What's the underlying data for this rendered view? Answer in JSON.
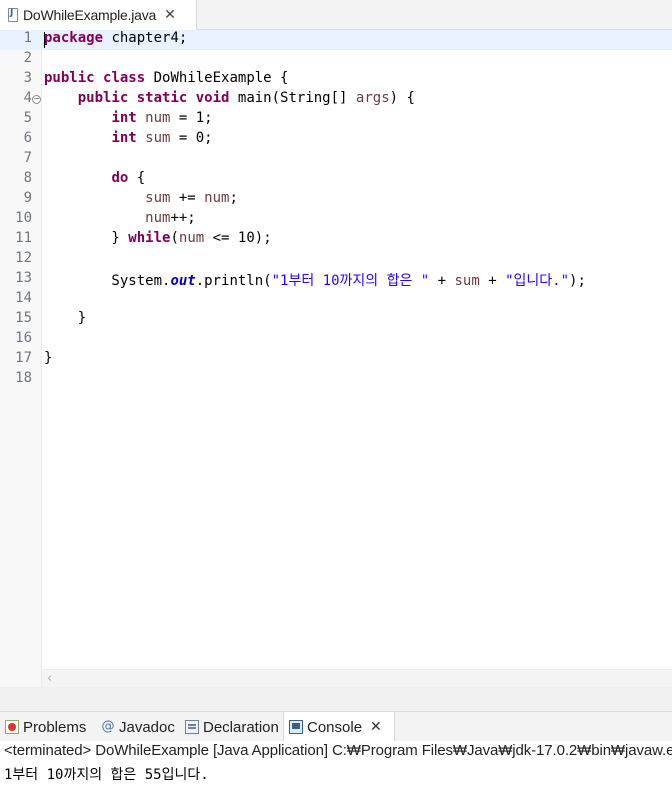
{
  "editor_tab": {
    "title": "DoWhileExample.java",
    "close_glyph": "✕"
  },
  "code_lines": [
    {
      "n": "1",
      "tokens": [
        {
          "t": "package",
          "c": "kw"
        },
        {
          "t": " chapter4;",
          "c": ""
        }
      ]
    },
    {
      "n": "2",
      "tokens": []
    },
    {
      "n": "3",
      "tokens": [
        {
          "t": "public",
          "c": "kw"
        },
        {
          "t": " ",
          "c": ""
        },
        {
          "t": "class",
          "c": "kw"
        },
        {
          "t": " DoWhileExample {",
          "c": ""
        }
      ]
    },
    {
      "n": "4",
      "fold": true,
      "tokens": [
        {
          "t": "    ",
          "c": ""
        },
        {
          "t": "public",
          "c": "kw"
        },
        {
          "t": " ",
          "c": ""
        },
        {
          "t": "static",
          "c": "kw"
        },
        {
          "t": " ",
          "c": ""
        },
        {
          "t": "void",
          "c": "kw"
        },
        {
          "t": " main(String[] ",
          "c": ""
        },
        {
          "t": "args",
          "c": "param"
        },
        {
          "t": ") {",
          "c": ""
        }
      ]
    },
    {
      "n": "5",
      "tokens": [
        {
          "t": "        ",
          "c": ""
        },
        {
          "t": "int",
          "c": "kw"
        },
        {
          "t": " ",
          "c": ""
        },
        {
          "t": "num",
          "c": "var"
        },
        {
          "t": " = 1;",
          "c": ""
        }
      ]
    },
    {
      "n": "6",
      "tokens": [
        {
          "t": "        ",
          "c": ""
        },
        {
          "t": "int",
          "c": "kw"
        },
        {
          "t": " ",
          "c": ""
        },
        {
          "t": "sum",
          "c": "var"
        },
        {
          "t": " = 0;",
          "c": ""
        }
      ]
    },
    {
      "n": "7",
      "tokens": []
    },
    {
      "n": "8",
      "tokens": [
        {
          "t": "        ",
          "c": ""
        },
        {
          "t": "do",
          "c": "kw"
        },
        {
          "t": " {",
          "c": ""
        }
      ]
    },
    {
      "n": "9",
      "tokens": [
        {
          "t": "            ",
          "c": ""
        },
        {
          "t": "sum",
          "c": "var"
        },
        {
          "t": " += ",
          "c": ""
        },
        {
          "t": "num",
          "c": "var"
        },
        {
          "t": ";",
          "c": ""
        }
      ]
    },
    {
      "n": "10",
      "tokens": [
        {
          "t": "            ",
          "c": ""
        },
        {
          "t": "num",
          "c": "var"
        },
        {
          "t": "++;",
          "c": ""
        }
      ]
    },
    {
      "n": "11",
      "tokens": [
        {
          "t": "        } ",
          "c": ""
        },
        {
          "t": "while",
          "c": "kw"
        },
        {
          "t": "(",
          "c": ""
        },
        {
          "t": "num",
          "c": "var"
        },
        {
          "t": " <= 10);",
          "c": ""
        }
      ]
    },
    {
      "n": "12",
      "tokens": []
    },
    {
      "n": "13",
      "tokens": [
        {
          "t": "        System.",
          "c": ""
        },
        {
          "t": "out",
          "c": "static"
        },
        {
          "t": ".println(",
          "c": ""
        },
        {
          "t": "\"1부터 10까지의 합은 \"",
          "c": "str"
        },
        {
          "t": " + ",
          "c": ""
        },
        {
          "t": "sum",
          "c": "var"
        },
        {
          "t": " + ",
          "c": ""
        },
        {
          "t": "\"입니다.\"",
          "c": "str"
        },
        {
          "t": ");",
          "c": ""
        }
      ]
    },
    {
      "n": "14",
      "tokens": []
    },
    {
      "n": "15",
      "tokens": [
        {
          "t": "    }",
          "c": ""
        }
      ]
    },
    {
      "n": "16",
      "tokens": []
    },
    {
      "n": "17",
      "tokens": [
        {
          "t": "}",
          "c": ""
        }
      ]
    },
    {
      "n": "18",
      "tokens": []
    }
  ],
  "view_tabs": [
    {
      "label": "Problems",
      "icon": "problems-icon",
      "active": false
    },
    {
      "label": "Javadoc",
      "icon": "javadoc-icon",
      "active": false
    },
    {
      "label": "Declaration",
      "icon": "declaration-icon",
      "active": false
    },
    {
      "label": "Console",
      "icon": "console-icon",
      "active": true
    }
  ],
  "console": {
    "terminated_line": "<terminated> DoWhileExample [Java Application] C:₩Program Files₩Java₩jdk-17.0.2₩bin₩javaw.exe",
    "output": "1부터 10까지의 합은 55입니다."
  },
  "colors": {
    "keyword": "#7f0055",
    "string": "#2a00ff",
    "local_variable": "#6a3e3e",
    "static_field": "#0000c0",
    "current_line": "#e8f2fe"
  }
}
